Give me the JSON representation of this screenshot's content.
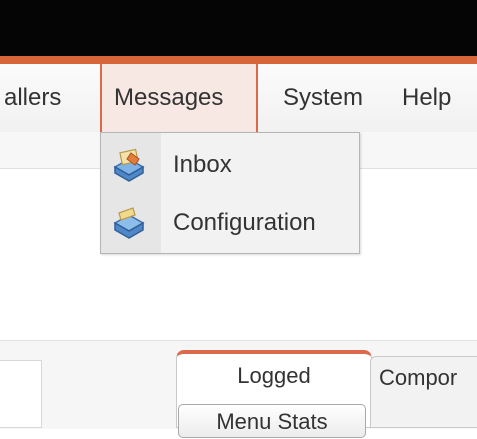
{
  "menubar": {
    "items": [
      {
        "label": "allers"
      },
      {
        "label": "Messages"
      },
      {
        "label": "System"
      },
      {
        "label": "Help"
      }
    ]
  },
  "dropdown": {
    "items": [
      {
        "label": "Inbox",
        "icon": "inbox-icon"
      },
      {
        "label": "Configuration",
        "icon": "configuration-icon"
      }
    ]
  },
  "panel": {
    "tabs": [
      {
        "label": "Logged"
      },
      {
        "label": "Compor"
      }
    ],
    "menu_stats_label": "Menu Stats"
  },
  "colors": {
    "accent": "#d8653a",
    "active_menu_bg": "#f7e8e4"
  }
}
